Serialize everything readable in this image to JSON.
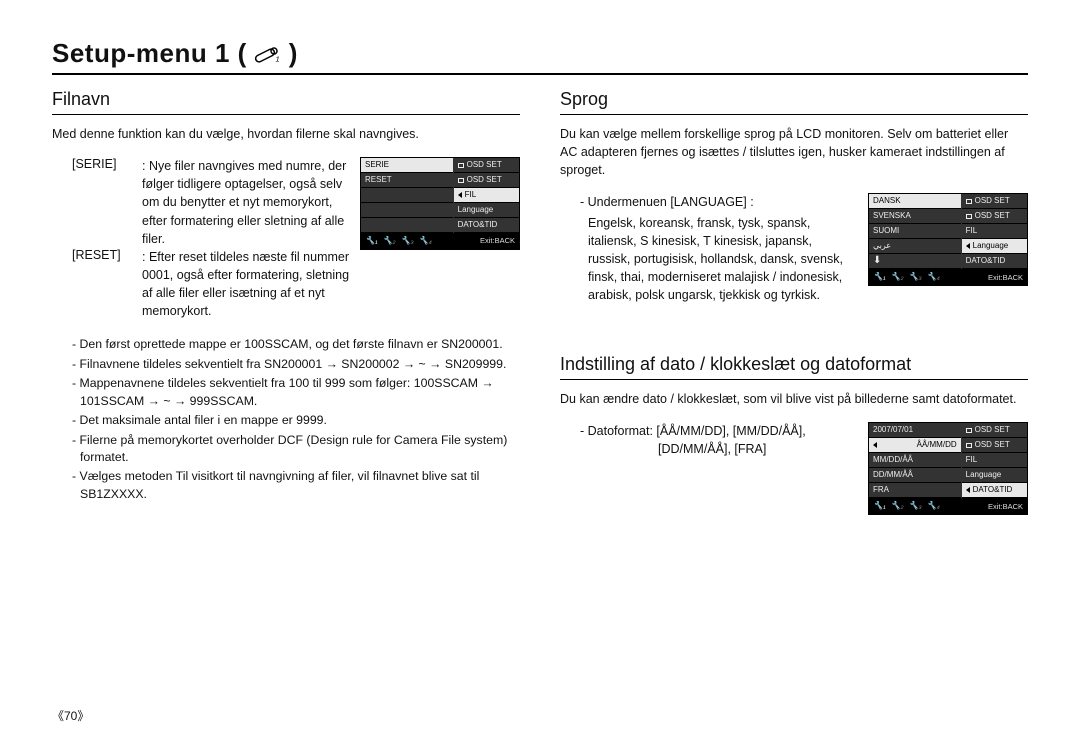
{
  "page": {
    "title": "Setup-menu 1 (",
    "title_close": ")",
    "page_number": "《70》"
  },
  "left": {
    "heading": "Filnavn",
    "intro": "Med denne funktion kan du vælge, hvordan filerne skal navngives.",
    "defs": [
      {
        "label": "[SERIE]",
        "body": ": Nye filer navngives med numre, der følger tidligere optagelser, også selv om du benytter et nyt memorykort, efter formatering eller sletning af alle filer."
      },
      {
        "label": "[RESET]",
        "body": ": Efter reset tildeles næste fil nummer 0001, også efter formatering, sletning af alle filer eller isætning af et nyt memorykort."
      }
    ],
    "notes": [
      "- Den først oprettede mappe er 100SSCAM, og det første filnavn er SN200001.",
      "- Filnavnene tildeles sekventielt fra SN200001 → SN200002 → ~ → SN209999.",
      "- Mappenavnene tildeles sekventielt fra 100 til 999 som følger: 100SSCAM → 101SSCAM → ~ → 999SSCAM.",
      "- Det maksimale antal filer i en mappe er 9999.",
      "- Filerne på memorykortet overholder DCF (Design rule for Camera File system) formatet.",
      "- Vælges metoden Til visitkort til navngivning af filer, vil filnavnet blive sat til SB1ZXXXX."
    ],
    "lcd": {
      "left_items": [
        "SERIE",
        "RESET",
        "",
        "",
        ""
      ],
      "right_items": [
        "OSD SET",
        "OSD SET",
        "FIL",
        "Language",
        "DATO&TID"
      ],
      "hl_left": 0,
      "hl_right": 2,
      "exit": "Exit:BACK"
    }
  },
  "right_top": {
    "heading": "Sprog",
    "intro": "Du kan vælge mellem forskellige sprog på LCD monitoren. Selv om batteriet eller AC adapteren fjernes og isættes / tilsluttes igen, husker kameraet indstillingen af sproget.",
    "sub_head": "- Undermenuen [LANGUAGE] :",
    "sub_body": "Engelsk, koreansk, fransk, tysk, spansk, italiensk, S kinesisk, T kinesisk, japansk, russisk, portugisisk, hollandsk, dansk, svensk, finsk, thai, moderniseret malajisk / indonesisk, arabisk, polsk ungarsk, tjekkisk og tyrkisk.",
    "lcd": {
      "left_items": [
        "DANSK",
        "SVENSKA",
        "SUOMI",
        "عربي",
        "⬇"
      ],
      "right_items": [
        "OSD SET",
        "OSD SET",
        "FIL",
        "Language",
        "DATO&TID"
      ],
      "hl_left": 0,
      "hl_right": 3,
      "exit": "Exit:BACK"
    }
  },
  "right_bottom": {
    "heading": "Indstilling af dato / klokkeslæt og datoformat",
    "intro": "Du kan ændre dato / klokkeslæt, som vil blive vist på billederne samt datoformatet.",
    "line1": "- Datoformat: [ÅÅ/MM/DD], [MM/DD/ÅÅ],",
    "line2_indent": "[DD/MM/ÅÅ], [FRA]",
    "lcd": {
      "left_items": [
        "2007/07/01",
        "ÅÅ/MM/DD",
        "MM/DD/ÅÅ",
        "DD/MM/ÅÅ",
        "FRA"
      ],
      "right_items": [
        "OSD SET",
        "OSD SET",
        "FIL",
        "Language",
        "DATO&TID"
      ],
      "hl_left": 1,
      "hl_right": 4,
      "exit": "Exit:BACK"
    }
  }
}
